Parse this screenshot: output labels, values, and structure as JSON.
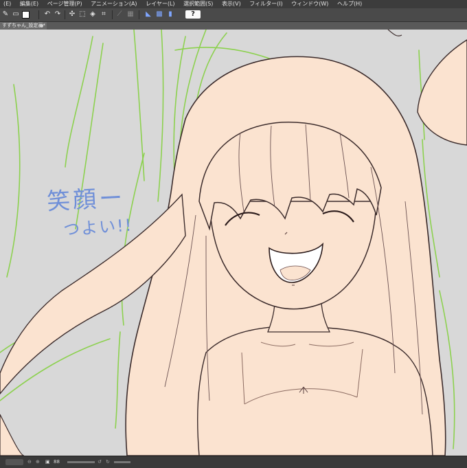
{
  "menu": [
    "(E)",
    "編集(E)",
    "ページ管理(P)",
    "アニメーション(A)",
    "レイヤー(L)",
    "選択範囲(S)",
    "表示(V)",
    "フィルター(I)",
    "ウィンドウ(W)",
    "ヘルプ(H)"
  ],
  "tab": {
    "title": "すずちゃん_設定画*"
  },
  "annotation": {
    "line1": "笑顔ー",
    "line2": "つよい!!"
  },
  "status": {
    "zoom": "88"
  },
  "colors": {
    "ui_dark": "#3c3c3c",
    "canvas_bg": "#d8d8d8",
    "skin": "#fbe3d0",
    "lineart": "#3a2a2a",
    "sketch_green": "#8cd14e",
    "annotation_blue": "#6f8fd8"
  },
  "icons": [
    "pen-tool-icon",
    "new-file-icon",
    "open-file-icon",
    "color-swatch-icon",
    "undo-icon",
    "redo-icon",
    "transform-icon",
    "select-icon",
    "fill-icon",
    "crop-icon",
    "ruler-icon",
    "snap-icon",
    "help-icon"
  ]
}
